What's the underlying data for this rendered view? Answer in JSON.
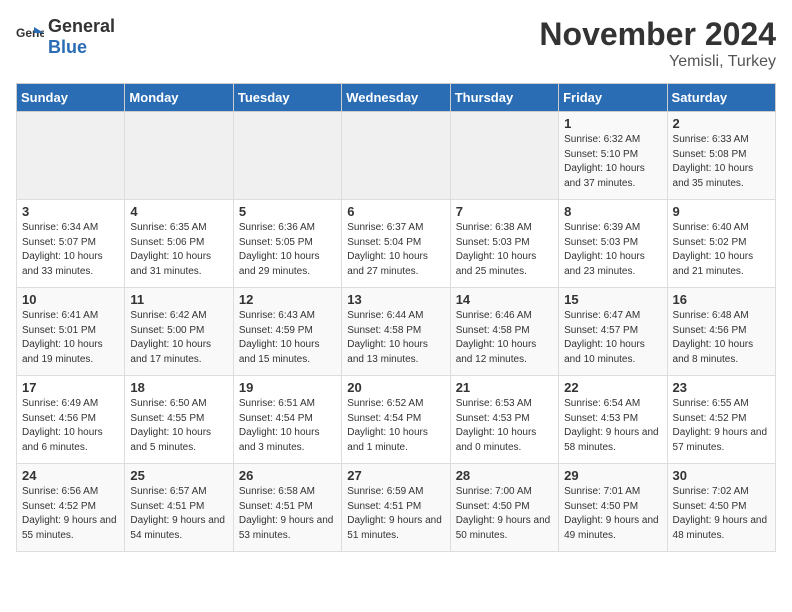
{
  "logo": {
    "text_general": "General",
    "text_blue": "Blue"
  },
  "header": {
    "month": "November 2024",
    "location": "Yemisli, Turkey"
  },
  "weekdays": [
    "Sunday",
    "Monday",
    "Tuesday",
    "Wednesday",
    "Thursday",
    "Friday",
    "Saturday"
  ],
  "weeks": [
    [
      {
        "day": "",
        "info": ""
      },
      {
        "day": "",
        "info": ""
      },
      {
        "day": "",
        "info": ""
      },
      {
        "day": "",
        "info": ""
      },
      {
        "day": "",
        "info": ""
      },
      {
        "day": "1",
        "info": "Sunrise: 6:32 AM\nSunset: 5:10 PM\nDaylight: 10 hours and 37 minutes."
      },
      {
        "day": "2",
        "info": "Sunrise: 6:33 AM\nSunset: 5:08 PM\nDaylight: 10 hours and 35 minutes."
      }
    ],
    [
      {
        "day": "3",
        "info": "Sunrise: 6:34 AM\nSunset: 5:07 PM\nDaylight: 10 hours and 33 minutes."
      },
      {
        "day": "4",
        "info": "Sunrise: 6:35 AM\nSunset: 5:06 PM\nDaylight: 10 hours and 31 minutes."
      },
      {
        "day": "5",
        "info": "Sunrise: 6:36 AM\nSunset: 5:05 PM\nDaylight: 10 hours and 29 minutes."
      },
      {
        "day": "6",
        "info": "Sunrise: 6:37 AM\nSunset: 5:04 PM\nDaylight: 10 hours and 27 minutes."
      },
      {
        "day": "7",
        "info": "Sunrise: 6:38 AM\nSunset: 5:03 PM\nDaylight: 10 hours and 25 minutes."
      },
      {
        "day": "8",
        "info": "Sunrise: 6:39 AM\nSunset: 5:03 PM\nDaylight: 10 hours and 23 minutes."
      },
      {
        "day": "9",
        "info": "Sunrise: 6:40 AM\nSunset: 5:02 PM\nDaylight: 10 hours and 21 minutes."
      }
    ],
    [
      {
        "day": "10",
        "info": "Sunrise: 6:41 AM\nSunset: 5:01 PM\nDaylight: 10 hours and 19 minutes."
      },
      {
        "day": "11",
        "info": "Sunrise: 6:42 AM\nSunset: 5:00 PM\nDaylight: 10 hours and 17 minutes."
      },
      {
        "day": "12",
        "info": "Sunrise: 6:43 AM\nSunset: 4:59 PM\nDaylight: 10 hours and 15 minutes."
      },
      {
        "day": "13",
        "info": "Sunrise: 6:44 AM\nSunset: 4:58 PM\nDaylight: 10 hours and 13 minutes."
      },
      {
        "day": "14",
        "info": "Sunrise: 6:46 AM\nSunset: 4:58 PM\nDaylight: 10 hours and 12 minutes."
      },
      {
        "day": "15",
        "info": "Sunrise: 6:47 AM\nSunset: 4:57 PM\nDaylight: 10 hours and 10 minutes."
      },
      {
        "day": "16",
        "info": "Sunrise: 6:48 AM\nSunset: 4:56 PM\nDaylight: 10 hours and 8 minutes."
      }
    ],
    [
      {
        "day": "17",
        "info": "Sunrise: 6:49 AM\nSunset: 4:56 PM\nDaylight: 10 hours and 6 minutes."
      },
      {
        "day": "18",
        "info": "Sunrise: 6:50 AM\nSunset: 4:55 PM\nDaylight: 10 hours and 5 minutes."
      },
      {
        "day": "19",
        "info": "Sunrise: 6:51 AM\nSunset: 4:54 PM\nDaylight: 10 hours and 3 minutes."
      },
      {
        "day": "20",
        "info": "Sunrise: 6:52 AM\nSunset: 4:54 PM\nDaylight: 10 hours and 1 minute."
      },
      {
        "day": "21",
        "info": "Sunrise: 6:53 AM\nSunset: 4:53 PM\nDaylight: 10 hours and 0 minutes."
      },
      {
        "day": "22",
        "info": "Sunrise: 6:54 AM\nSunset: 4:53 PM\nDaylight: 9 hours and 58 minutes."
      },
      {
        "day": "23",
        "info": "Sunrise: 6:55 AM\nSunset: 4:52 PM\nDaylight: 9 hours and 57 minutes."
      }
    ],
    [
      {
        "day": "24",
        "info": "Sunrise: 6:56 AM\nSunset: 4:52 PM\nDaylight: 9 hours and 55 minutes."
      },
      {
        "day": "25",
        "info": "Sunrise: 6:57 AM\nSunset: 4:51 PM\nDaylight: 9 hours and 54 minutes."
      },
      {
        "day": "26",
        "info": "Sunrise: 6:58 AM\nSunset: 4:51 PM\nDaylight: 9 hours and 53 minutes."
      },
      {
        "day": "27",
        "info": "Sunrise: 6:59 AM\nSunset: 4:51 PM\nDaylight: 9 hours and 51 minutes."
      },
      {
        "day": "28",
        "info": "Sunrise: 7:00 AM\nSunset: 4:50 PM\nDaylight: 9 hours and 50 minutes."
      },
      {
        "day": "29",
        "info": "Sunrise: 7:01 AM\nSunset: 4:50 PM\nDaylight: 9 hours and 49 minutes."
      },
      {
        "day": "30",
        "info": "Sunrise: 7:02 AM\nSunset: 4:50 PM\nDaylight: 9 hours and 48 minutes."
      }
    ]
  ]
}
